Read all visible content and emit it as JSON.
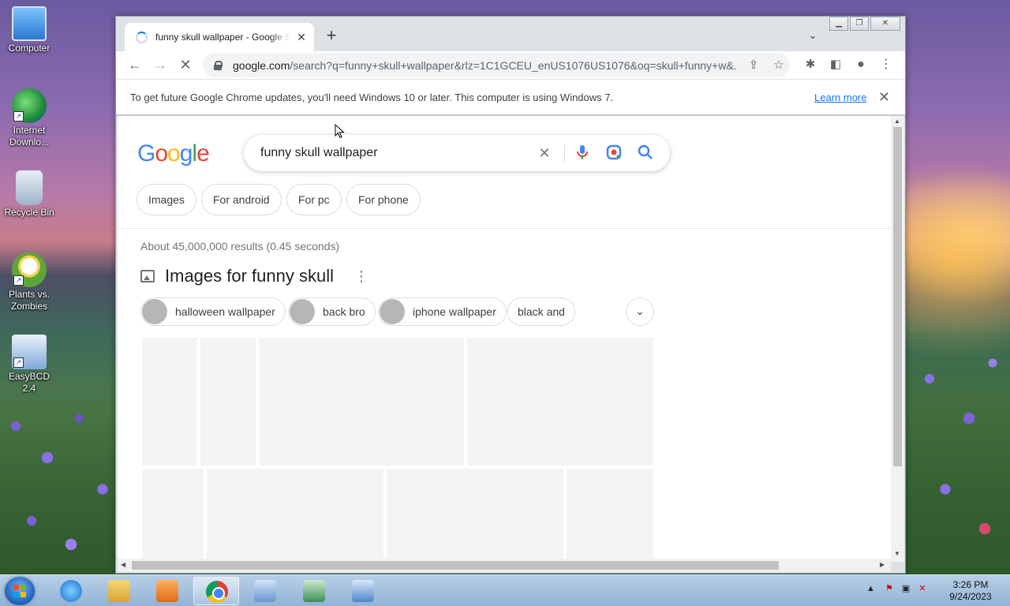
{
  "desktop": {
    "icons": [
      {
        "label": "Computer"
      },
      {
        "label": "Internet Downlo..."
      },
      {
        "label": "Recycle Bin"
      },
      {
        "label": "Plants vs. Zombies"
      },
      {
        "label": "EasyBCD 2.4"
      }
    ]
  },
  "browser": {
    "tab_title": "funny skull wallpaper - Google Search",
    "url_host": "google.com",
    "url_path": "/search?q=funny+skull+wallpaper&rlz=1C1GCEU_enUS1076US1076&oq=skull+funny+w&...",
    "infobar_message": "To get future Google Chrome updates, you'll need Windows 10 or later. This computer is using Windows 7.",
    "infobar_link": "Learn more"
  },
  "page": {
    "logo": "Google",
    "query": "funny skull wallpaper",
    "chips": [
      "Images",
      "For android",
      "For pc",
      "For phone"
    ],
    "results_stats": "About 45,000,000 results (0.45 seconds)",
    "images_heading": "Images for funny skull",
    "refine_chips": [
      "halloween wallpaper",
      "back bro",
      "iphone wallpaper",
      "black and"
    ]
  },
  "taskbar": {
    "time": "3:26 PM",
    "date": "9/24/2023"
  },
  "icons": [
    "computer-icon",
    "internet-download-manager-icon",
    "recycle-bin-icon",
    "plants-vs-zombies-icon",
    "easybcd-icon",
    "spinner-icon",
    "close-icon",
    "new-tab-icon",
    "back-icon",
    "forward-icon",
    "reload-icon",
    "lock-icon",
    "share-icon",
    "star-icon",
    "extensions-icon",
    "side-panel-icon",
    "profile-icon",
    "menu-icon",
    "mic-icon",
    "lens-icon",
    "search-icon",
    "image-icon",
    "more-icon",
    "chevron-down-icon"
  ],
  "colors": {
    "google_blue": "#4285f4",
    "google_red": "#ea4335",
    "google_yellow": "#fbbc05",
    "google_green": "#34a853",
    "link": "#1a73e8"
  }
}
